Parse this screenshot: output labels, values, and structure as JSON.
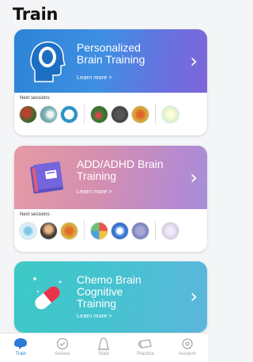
{
  "header": {
    "title": "Train"
  },
  "cards": [
    {
      "title_line1": "Personalized",
      "title_line2": "Brain Training",
      "learn_more": "Learn more >",
      "sessions_label": "Next sessions:"
    },
    {
      "title_line1": "ADD/ADHD Brain",
      "title_line2": "Training",
      "learn_more": "Learn more >",
      "sessions_label": "Next sessions:"
    },
    {
      "title_line1": "Chemo Brain",
      "title_line2": "Cognitive",
      "title_line3": "Training",
      "learn_more": "Learn more >"
    }
  ],
  "tabs": [
    {
      "label": "Train",
      "icon": "train-icon",
      "active": true
    },
    {
      "label": "Assess",
      "icon": "assess-icon"
    },
    {
      "label": "Stats",
      "icon": "stats-icon"
    },
    {
      "label": "Practice",
      "icon": "practice-icon"
    },
    {
      "label": "Account",
      "icon": "account-icon"
    }
  ],
  "colors": {
    "accent": "#2a7bd8",
    "card1_gradient": [
      "#2c84d6",
      "#7d66d8"
    ],
    "card2_gradient": [
      "#e59aa4",
      "#a78fd8"
    ],
    "card3_gradient": [
      "#3cc9c6",
      "#5cb6dc"
    ]
  }
}
